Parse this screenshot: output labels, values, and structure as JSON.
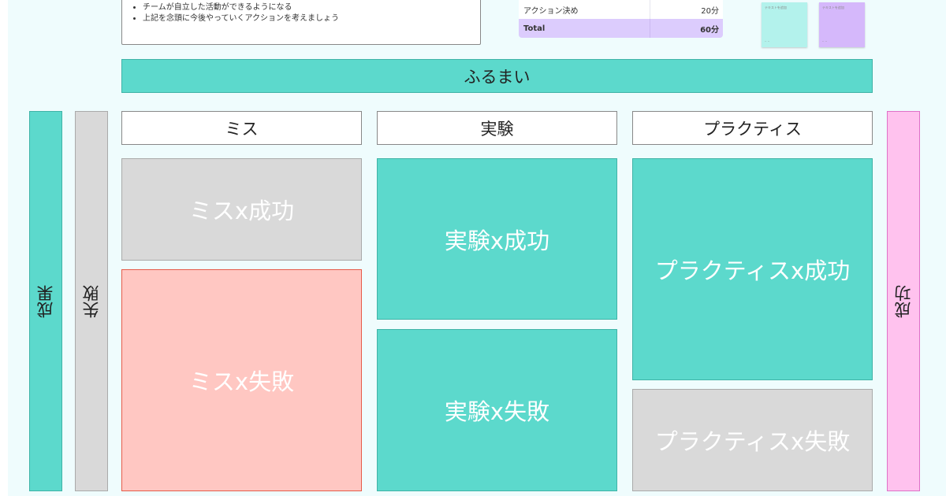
{
  "notes": [
    "チームが自立した活動ができるようになる",
    "上記を念頭に今後やっていくアクションを考えましょう"
  ],
  "table": {
    "rows": [
      {
        "label": "アクション決め",
        "value": "20分"
      },
      {
        "label": "Total",
        "value": "60分"
      }
    ]
  },
  "stickies": [
    {
      "text": "テキストを追加",
      "color": "#b3f2ec"
    },
    {
      "text": "テキストを追加",
      "color": "#d5b8fb"
    }
  ],
  "banner": "ふるまい",
  "side": {
    "left1": "成果",
    "left2": "失敗",
    "right": "成功"
  },
  "headers": [
    "ミス",
    "実験",
    "プラクティス"
  ],
  "cells": {
    "miss_success": "ミスx成功",
    "miss_fail": "ミスx失敗",
    "exp_success": "実験x成功",
    "exp_fail": "実験x失敗",
    "prac_success": "プラクティスx成功",
    "prac_fail": "プラクティスx失敗"
  },
  "colors": {
    "teal": "#5cd9cc",
    "gray": "#d9d9d9",
    "salmon": "#ffc7c2",
    "pink": "#ffc2ee",
    "purple": "#dcccfd"
  }
}
